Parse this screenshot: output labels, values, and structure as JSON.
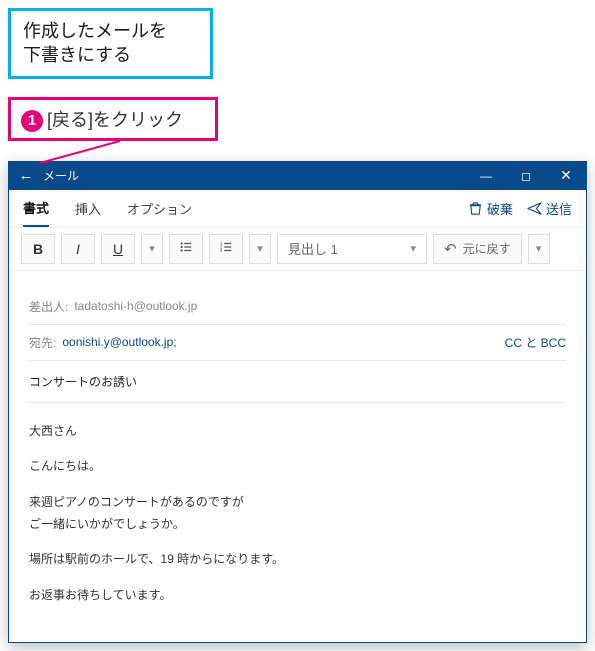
{
  "callouts": {
    "note": "作成したメールを\n下書きにする",
    "step1_num": "1",
    "step1_text": "[戻る]をクリック"
  },
  "window": {
    "title": "メール"
  },
  "tabs": {
    "format": "書式",
    "insert": "挿入",
    "options": "オプション"
  },
  "actions": {
    "discard": "破棄",
    "send": "送信"
  },
  "toolbar": {
    "bold": "B",
    "italic": "I",
    "underline": "U",
    "style_select": "見出し 1",
    "undo": "元に戻す"
  },
  "compose": {
    "from_label": "差出人:",
    "from_value": "tadatoshi-h@outlook.jp",
    "to_label": "宛先:",
    "to_value": "oonishi.y@outlook.jp;",
    "ccbcc": "CC と BCC",
    "subject": "コンサートのお誘い",
    "body": {
      "l1": "大西さん",
      "l2": "こんにちは。",
      "l3": "来週ピアノのコンサートがあるのですが",
      "l4": "ご一緒にいかがでしょうか。",
      "l5": "場所は駅前のホールで、19 時からになります。",
      "l6": "お返事お待ちしています。"
    }
  }
}
